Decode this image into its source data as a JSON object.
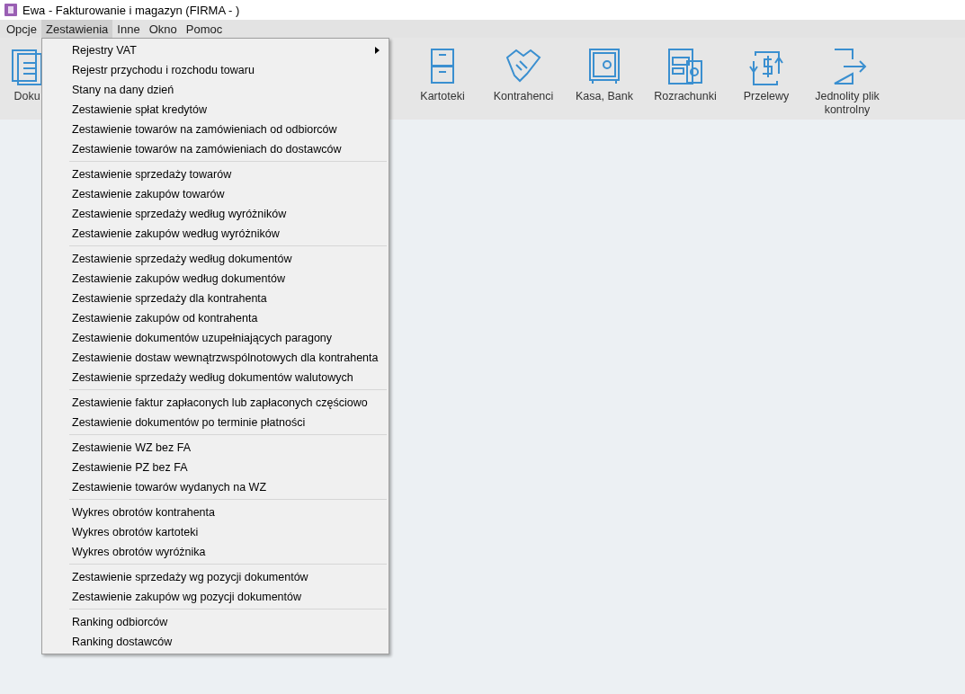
{
  "window": {
    "title": "Ewa - Fakturowanie i magazyn (FIRMA - )"
  },
  "menu_bar": [
    {
      "label": "Opcje",
      "selected": false
    },
    {
      "label": "Zestawienia",
      "selected": true
    },
    {
      "label": "Inne",
      "selected": false
    },
    {
      "label": "Okno",
      "selected": false
    },
    {
      "label": "Pomoc",
      "selected": false
    }
  ],
  "toolbar": [
    {
      "label": "Doku"
    },
    {
      "label": "Kartoteki"
    },
    {
      "label": "Kontrahenci"
    },
    {
      "label": "Kasa, Bank"
    },
    {
      "label": "Rozrachunki"
    },
    {
      "label": "Przelewy"
    },
    {
      "label": "Jednolity plik kontrolny"
    }
  ],
  "dropdown_menu": [
    [
      {
        "label": "Rejestry VAT",
        "submenu": true
      },
      {
        "label": "Rejestr przychodu i rozchodu towaru",
        "submenu": false
      },
      {
        "label": "Stany na dany dzień",
        "submenu": false
      },
      {
        "label": "Zestawienie spłat kredytów",
        "submenu": false
      },
      {
        "label": "Zestawienie towarów na zamówieniach od odbiorców",
        "submenu": false
      },
      {
        "label": "Zestawienie towarów na zamówieniach do dostawców",
        "submenu": false
      }
    ],
    [
      {
        "label": "Zestawienie sprzedaży towarów",
        "submenu": false
      },
      {
        "label": "Zestawienie zakupów towarów",
        "submenu": false
      },
      {
        "label": "Zestawienie sprzedaży według wyróżników",
        "submenu": false
      },
      {
        "label": "Zestawienie zakupów według wyróżników",
        "submenu": false
      }
    ],
    [
      {
        "label": "Zestawienie sprzedaży według dokumentów",
        "submenu": false
      },
      {
        "label": "Zestawienie zakupów według dokumentów",
        "submenu": false
      },
      {
        "label": "Zestawienie sprzedaży dla kontrahenta",
        "submenu": false
      },
      {
        "label": "Zestawienie zakupów od kontrahenta",
        "submenu": false
      },
      {
        "label": "Zestawienie dokumentów uzupełniających paragony",
        "submenu": false
      },
      {
        "label": "Zestawienie dostaw wewnątrzwspólnotowych dla kontrahenta",
        "submenu": false
      },
      {
        "label": "Zestawienie sprzedaży według dokumentów walutowych",
        "submenu": false
      }
    ],
    [
      {
        "label": "Zestawienie faktur zapłaconych lub zapłaconych częściowo",
        "submenu": false
      },
      {
        "label": "Zestawienie dokumentów po terminie płatności",
        "submenu": false
      }
    ],
    [
      {
        "label": "Zestawienie WZ bez FA",
        "submenu": false
      },
      {
        "label": "Zestawienie PZ bez FA",
        "submenu": false
      },
      {
        "label": "Zestawienie towarów wydanych na WZ",
        "submenu": false
      }
    ],
    [
      {
        "label": "Wykres obrotów kontrahenta",
        "submenu": false
      },
      {
        "label": "Wykres obrotów kartoteki",
        "submenu": false
      },
      {
        "label": "Wykres obrotów wyróżnika",
        "submenu": false
      }
    ],
    [
      {
        "label": "Zestawienie sprzedaży wg pozycji dokumentów",
        "submenu": false
      },
      {
        "label": "Zestawienie zakupów wg pozycji dokumentów",
        "submenu": false
      }
    ],
    [
      {
        "label": "Ranking odbiorców",
        "submenu": false
      },
      {
        "label": "Ranking dostawców",
        "submenu": false
      }
    ]
  ]
}
